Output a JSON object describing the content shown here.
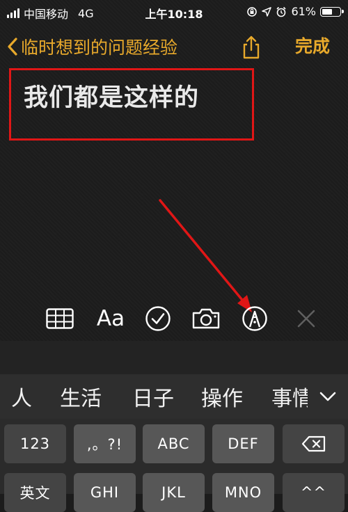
{
  "status_bar": {
    "carrier": "中国移动",
    "network": "4G",
    "time": "上午10:18",
    "battery": "61%",
    "battery_level": 0.61
  },
  "nav": {
    "back_label": "临时想到的问题经验",
    "done_label": "完成",
    "accent_color": "#e8a92b"
  },
  "note": {
    "body": "我们都是这样的"
  },
  "annotation": {
    "color": "#e01616"
  },
  "toolbar": {
    "icons": [
      "table-icon",
      "text-format-icon",
      "checklist-icon",
      "camera-icon",
      "markup-pen-icon",
      "close-icon"
    ],
    "format_label": "Aa"
  },
  "keyboard": {
    "candidates": [
      "人",
      "生活",
      "日子",
      "操作",
      "事情"
    ],
    "row1": [
      "123",
      ",。?!",
      "ABC",
      "DEF"
    ],
    "row2": [
      "英文",
      "GHI",
      "JKL",
      "MNO",
      "^^"
    ]
  }
}
